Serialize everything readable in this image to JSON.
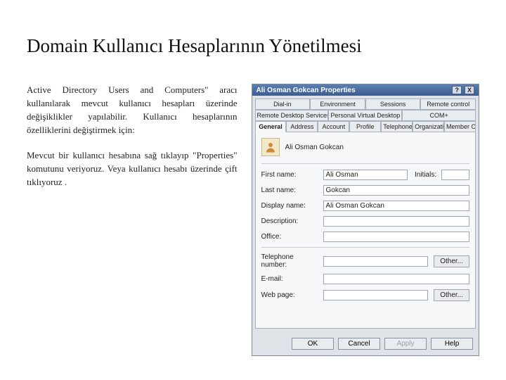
{
  "slide": {
    "title": "Domain Kullanıcı Hesaplarının Yönetilmesi",
    "para1": "Active Directory Users and Computers\" aracı kullanılarak mevcut kullanıcı hesapları üzerinde değişiklikler yapılabilir. Kullanıcı hesaplarının özelliklerini değiştirmek için:",
    "para2": "Mevcut bir kullanıcı hesabına sağ tıklayıp \"Properties\" komutunu veriyoruz. Veya kullanıcı hesabı üzerinde çift tıklıyoruz ."
  },
  "dialog": {
    "title": "Ali Osman Gokcan Properties",
    "tabs_row1": [
      "Dial-in",
      "Environment",
      "Sessions",
      "Remote control"
    ],
    "tabs_row2": [
      "Remote Desktop Services Profile",
      "Personal Virtual Desktop",
      "COM+"
    ],
    "tabs_row3": [
      "General",
      "Address",
      "Account",
      "Profile",
      "Telephones",
      "Organization",
      "Member Of"
    ],
    "active_tab_index_row3": 0,
    "username_display": "Ali Osman Gokcan",
    "fields": {
      "first_name_label": "First name:",
      "first_name_value": "Ali Osman",
      "initials_label": "Initials:",
      "initials_value": "",
      "last_name_label": "Last name:",
      "last_name_value": "Gokcan",
      "display_name_label": "Display name:",
      "display_name_value": "Ali Osman Gokcan",
      "description_label": "Description:",
      "description_value": "",
      "office_label": "Office:",
      "office_value": "",
      "telephone_label": "Telephone number:",
      "telephone_value": "",
      "email_label": "E-mail:",
      "email_value": "",
      "webpage_label": "Web page:",
      "webpage_value": ""
    },
    "other_button": "Other...",
    "buttons": {
      "ok": "OK",
      "cancel": "Cancel",
      "apply": "Apply",
      "help": "Help"
    },
    "window_help": "?",
    "window_close": "X"
  }
}
